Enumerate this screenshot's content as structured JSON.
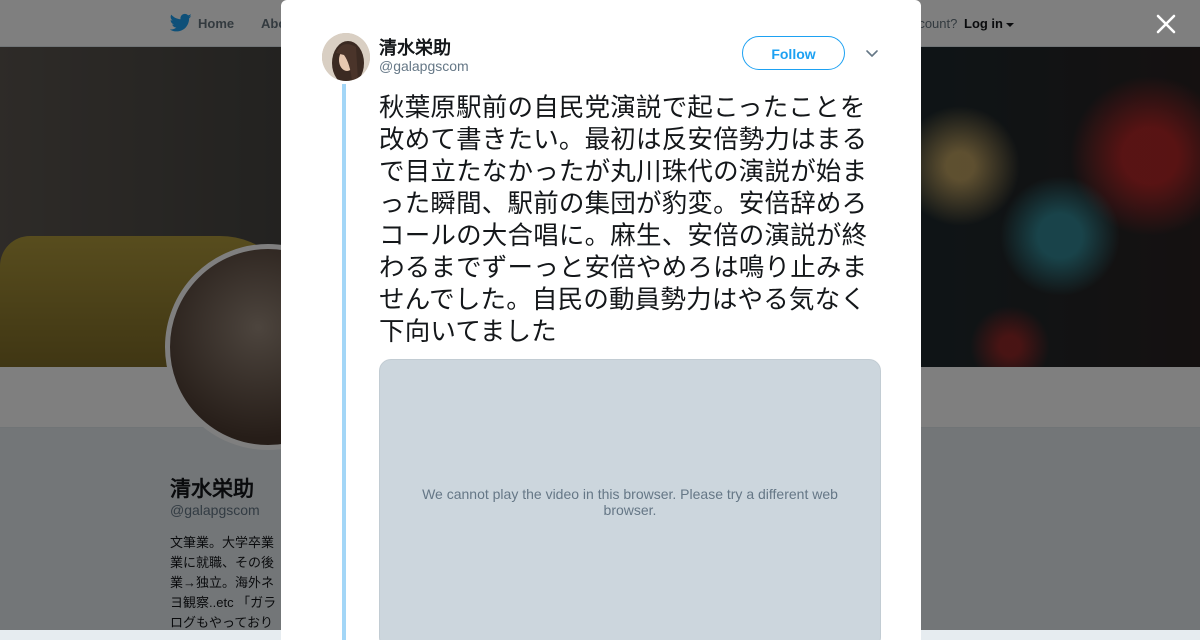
{
  "nav": {
    "home_label": "Home",
    "about_label": "Abo",
    "login_prompt": "ccount?",
    "login_label": "Log in"
  },
  "profile": {
    "name": "清水栄助",
    "handle": "@galapgscom",
    "bio_lines": [
      "文筆業。大学卒業",
      "業に就職、その後",
      "業→独立。海外ネ",
      "ヨ観察..etc 「ガラ",
      "ログもやっており"
    ]
  },
  "tweet": {
    "author_name": "清水栄助",
    "author_handle": "@galapgscom",
    "follow_label": "Follow",
    "text": "秋葉原駅前の自民党演説で起こったことを改めて書きたい。最初は反安倍勢力はまるで目立たなかったが丸川珠代の演説が始まった瞬間、駅前の集団が豹変。安倍辞めろコールの大合唱に。麻生、安倍の演説が終わるまでずーっと安倍やめろは鳴り止みませんでした。自民の動員勢力はやる気なく下向いてました",
    "video_message": "We cannot play the video in this browser. Please try a different web browser."
  },
  "icons": {
    "brand": "twitter-bird-icon",
    "close": "close-icon",
    "more": "chevron-down-icon"
  },
  "colors": {
    "accent": "#1da1f2",
    "thread": "#a3d6f7",
    "video_bg": "#ccd6dd"
  }
}
